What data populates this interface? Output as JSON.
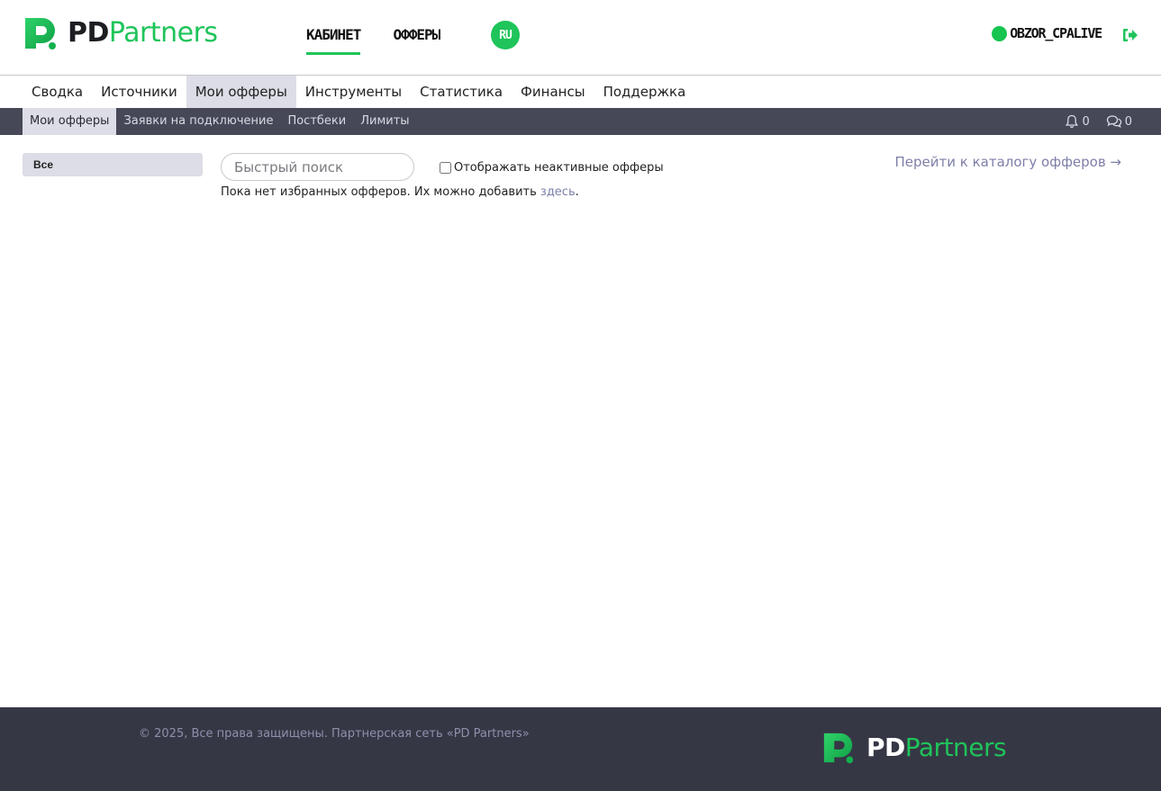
{
  "brand": {
    "pd": "PD",
    "partners": "Partners",
    "accent": "#1fc45a"
  },
  "header": {
    "nav": [
      {
        "label": "КАБИНЕТ",
        "active": true
      },
      {
        "label": "ОФФЕРЫ",
        "active": false
      }
    ],
    "lang": "RU",
    "user": {
      "name": "OBZOR_CPALIVE",
      "status_color": "#16c44f"
    }
  },
  "main_nav": [
    {
      "label": "Сводка"
    },
    {
      "label": "Источники"
    },
    {
      "label": "Мои офферы",
      "active": true
    },
    {
      "label": "Инструменты"
    },
    {
      "label": "Статистика"
    },
    {
      "label": "Финансы"
    },
    {
      "label": "Поддержка"
    }
  ],
  "sub_nav": [
    {
      "label": "Мои офферы",
      "active": true
    },
    {
      "label": "Заявки на подключение"
    },
    {
      "label": "Постбеки"
    },
    {
      "label": "Лимиты"
    }
  ],
  "counters": {
    "notifications": "0",
    "messages": "0"
  },
  "sidebar": {
    "all_label": "Все"
  },
  "search": {
    "placeholder": "Быстрый поиск",
    "value": ""
  },
  "inactive_checkbox": {
    "label": "Отображать неактивные офферы",
    "checked": false
  },
  "catalog_link": "Перейти к каталогу офферов →",
  "empty_state": {
    "text": "Пока нет избранных офферов. Их можно добавить ",
    "link": "здесь",
    "tail": "."
  },
  "footer": {
    "copyright": "© 2025, Все права защищены. Партнерская сеть «PD Partners»"
  }
}
